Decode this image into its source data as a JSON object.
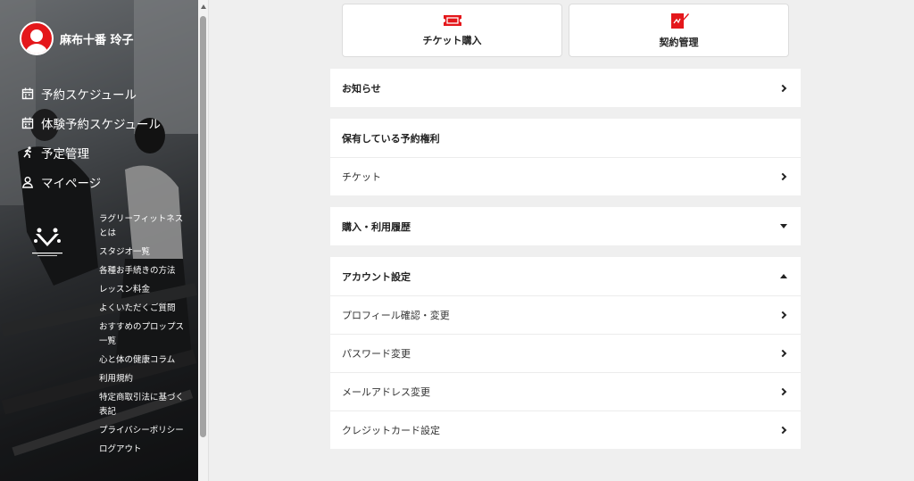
{
  "colors": {
    "accent": "#e4171b",
    "background": "#efefef",
    "card": "#ffffff"
  },
  "profile": {
    "name": "麻布十番 玲子",
    "icon": "avatar-icon"
  },
  "sidebar_nav": [
    {
      "label": "予約スケジュール",
      "icon": "calendar-icon"
    },
    {
      "label": "体験予約スケジュール",
      "icon": "calendar-icon"
    },
    {
      "label": "予定管理",
      "icon": "runner-icon"
    },
    {
      "label": "マイページ",
      "icon": "user-icon"
    }
  ],
  "footer_links": [
    "ラグリーフィットネスとは",
    "スタジオ一覧",
    "各種お手続きの方法",
    "レッスン料金",
    "よくいただくご質問",
    "おすすめのプロップス一覧",
    "心と体の健康コラム",
    "利用規約",
    "特定商取引法に基づく表記",
    "プライバシーポリシー",
    "ログアウト"
  ],
  "cards": [
    {
      "label": "チケット購入",
      "icon": "ticket-icon"
    },
    {
      "label": "契約管理",
      "icon": "contract-icon"
    }
  ],
  "sections": {
    "news": {
      "label": "お知らせ"
    },
    "rights": {
      "label": "保有している予約権利",
      "items": [
        "チケット"
      ]
    },
    "history": {
      "label": "購入・利用履歴"
    },
    "account": {
      "label": "アカウント設定",
      "items": [
        "プロフィール確認・変更",
        "パスワード変更",
        "メールアドレス変更",
        "クレジットカード設定"
      ]
    }
  }
}
